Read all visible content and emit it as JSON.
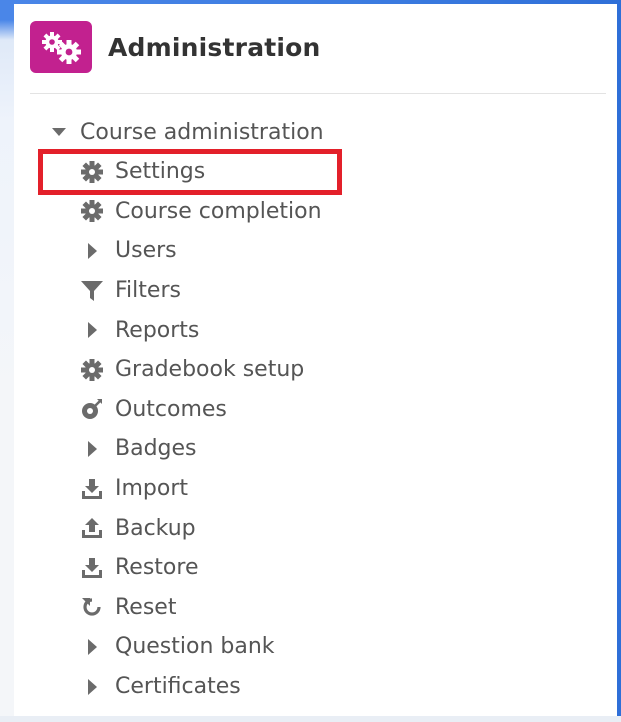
{
  "block": {
    "title": "Administration",
    "icon": "gears-icon",
    "accent_color": "#c2218f"
  },
  "tree": {
    "root_label": "Course administration",
    "items": [
      {
        "label": "Settings",
        "icon": "gear-icon",
        "highlighted": true
      },
      {
        "label": "Course completion",
        "icon": "gear-icon"
      },
      {
        "label": "Users",
        "icon": "caret-right-icon"
      },
      {
        "label": "Filters",
        "icon": "filter-icon"
      },
      {
        "label": "Reports",
        "icon": "caret-right-icon"
      },
      {
        "label": "Gradebook setup",
        "icon": "gear-icon"
      },
      {
        "label": "Outcomes",
        "icon": "outcomes-icon"
      },
      {
        "label": "Badges",
        "icon": "caret-right-icon"
      },
      {
        "label": "Import",
        "icon": "download-icon"
      },
      {
        "label": "Backup",
        "icon": "upload-icon"
      },
      {
        "label": "Restore",
        "icon": "download-icon"
      },
      {
        "label": "Reset",
        "icon": "reset-icon"
      },
      {
        "label": "Question bank",
        "icon": "caret-right-icon"
      },
      {
        "label": "Certificates",
        "icon": "caret-right-icon"
      }
    ]
  },
  "highlight_color": "#e3202a"
}
